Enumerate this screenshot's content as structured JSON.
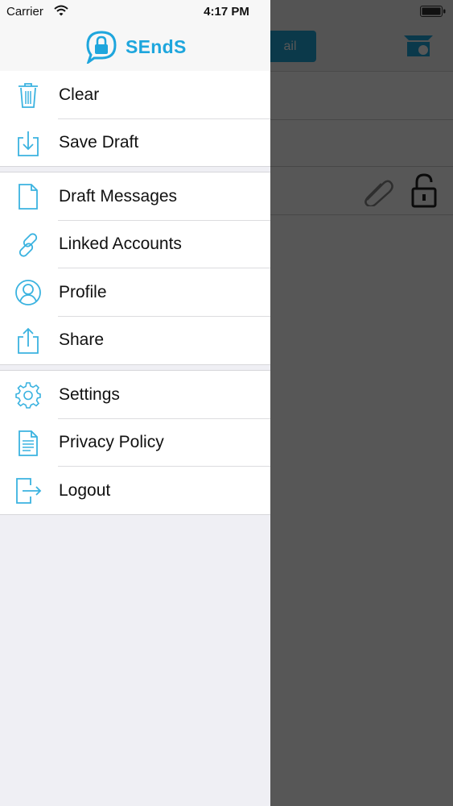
{
  "status_bar": {
    "carrier": "Carrier",
    "time": "4:17 PM"
  },
  "background_app": {
    "compose_button_label": "ail"
  },
  "drawer": {
    "logo_text": "SEndS",
    "groups": [
      {
        "items": [
          {
            "label": "Clear",
            "icon": "trash-icon"
          },
          {
            "label": "Save Draft",
            "icon": "download-icon"
          }
        ]
      },
      {
        "items": [
          {
            "label": "Draft Messages",
            "icon": "document-icon"
          },
          {
            "label": "Linked Accounts",
            "icon": "link-icon"
          },
          {
            "label": "Profile",
            "icon": "user-circle-icon"
          },
          {
            "label": "Share",
            "icon": "share-icon"
          }
        ]
      },
      {
        "items": [
          {
            "label": "Settings",
            "icon": "gear-icon"
          },
          {
            "label": "Privacy Policy",
            "icon": "document-text-icon"
          },
          {
            "label": "Logout",
            "icon": "logout-icon"
          }
        ]
      }
    ]
  },
  "colors": {
    "accent": "#1ea6dd",
    "overlay": "#555555",
    "drawer_background": "#efeff4"
  }
}
